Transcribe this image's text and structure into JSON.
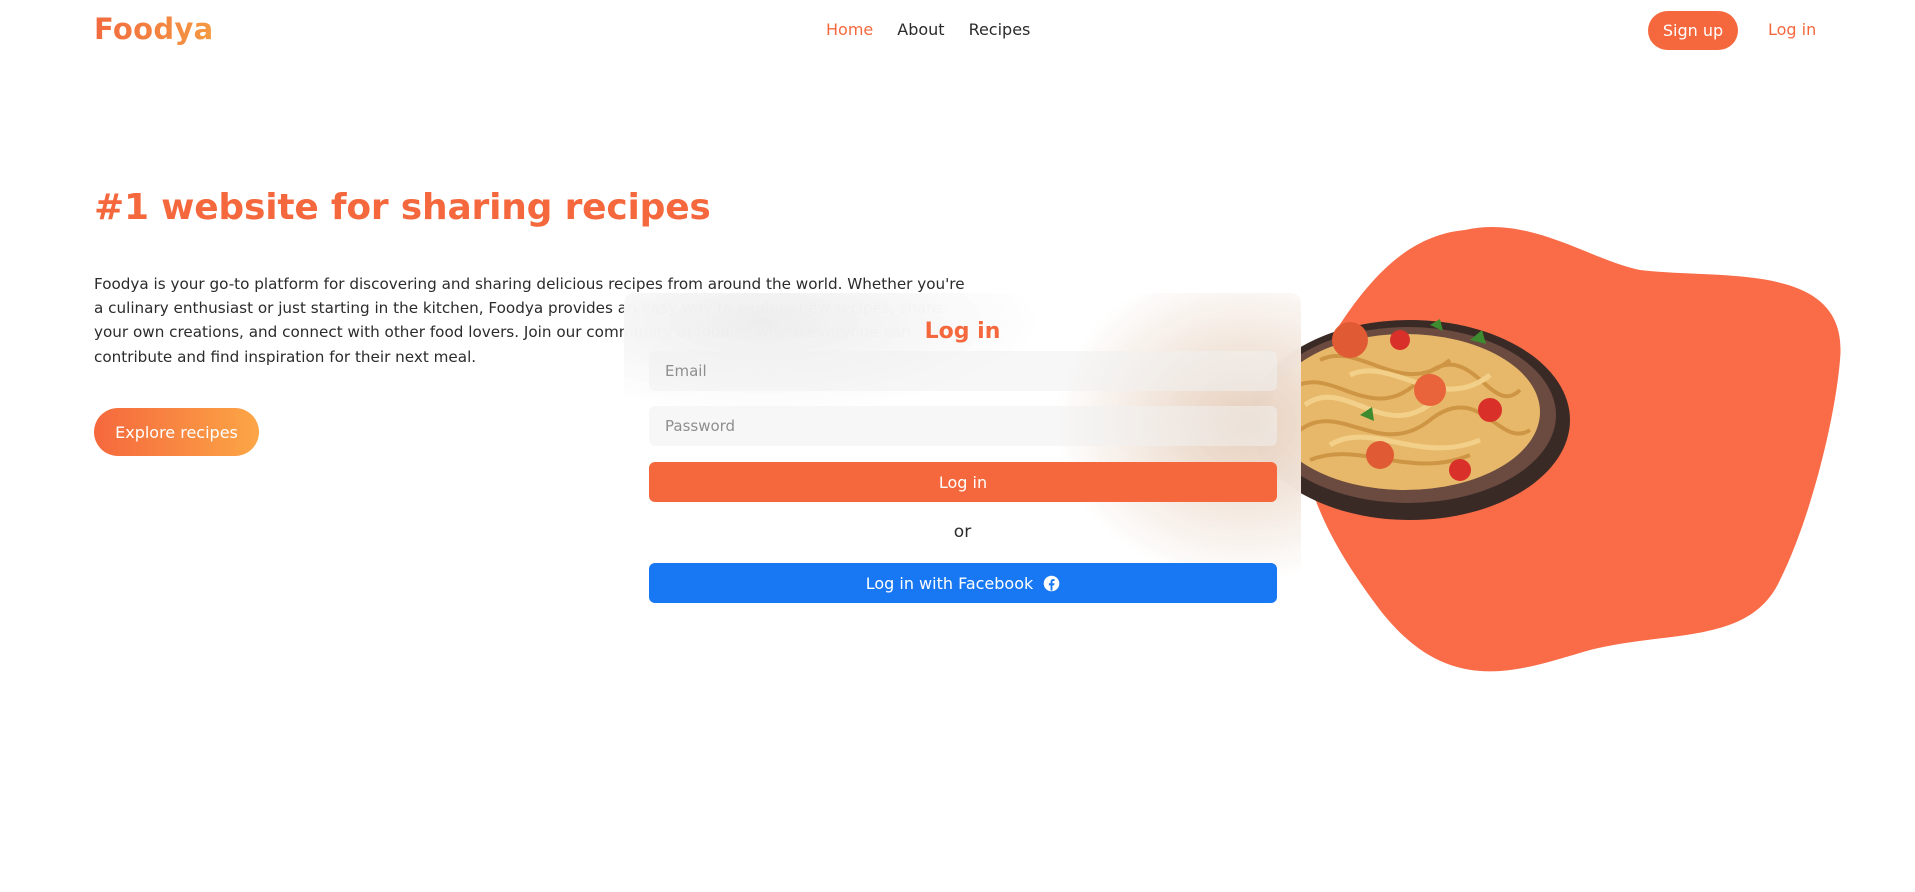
{
  "brand": {
    "name": "Foodya",
    "accent": "#f5683d",
    "accent_light": "#fca646",
    "facebook_blue": "#1877f2"
  },
  "nav": {
    "items": [
      {
        "label": "Home",
        "active": true
      },
      {
        "label": "About",
        "active": false
      },
      {
        "label": "Recipes",
        "active": false
      }
    ]
  },
  "header": {
    "signup_label": "Sign up",
    "login_label": "Log in"
  },
  "hero": {
    "title": "#1 website for sharing recipes",
    "paragraph": "Foodya is your go-to platform for discovering and sharing delicious recipes from around the world. Whether you're a culinary enthusiast or just starting in the kitchen, Foodya provides an easy way to explore new recipes, share your own creations, and connect with other food lovers. Join our community of foodies where everyone can contribute and find inspiration for their next meal.",
    "cta_label": "Explore recipes"
  },
  "login_modal": {
    "title": "Log in",
    "email_placeholder": "Email",
    "password_placeholder": "Password",
    "submit_label": "Log in",
    "or_label": "or",
    "facebook_label": "Log in with Facebook",
    "facebook_icon": "facebook-icon"
  },
  "illustration": {
    "blob_color": "#f96c47",
    "image": "pasta-plate"
  }
}
